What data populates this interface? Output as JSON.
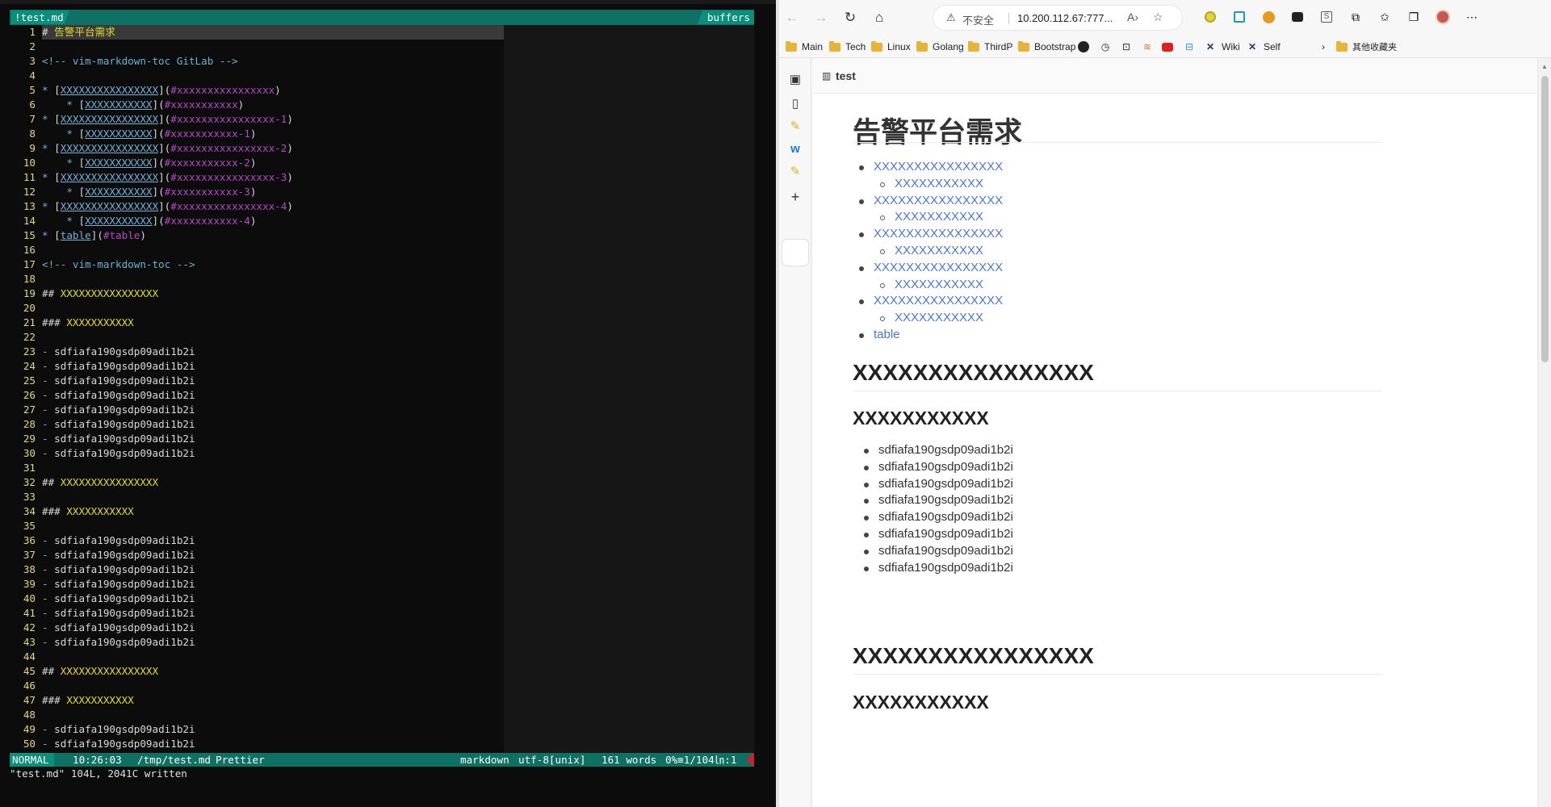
{
  "vim": {
    "tab": "!test.md",
    "buffers_label": "buffers",
    "lines": [
      {
        "n": "1",
        "parts": [
          {
            "t": "# ",
            "c": "c-plain"
          },
          {
            "t": "告警平台需求",
            "c": "c-head"
          }
        ]
      },
      {
        "n": "2",
        "parts": []
      },
      {
        "n": "3",
        "parts": [
          {
            "t": "<!-- vim-markdown-toc GitLab -->",
            "c": "c-comment"
          }
        ]
      },
      {
        "n": "4",
        "parts": []
      },
      {
        "n": "5",
        "parts": [
          {
            "t": "* ",
            "c": "c-bullet"
          },
          {
            "t": "[",
            "c": "c-plain"
          },
          {
            "t": "XXXXXXXXXXXXXXXX",
            "c": "c-link"
          },
          {
            "t": "](",
            "c": "c-plain"
          },
          {
            "t": "#xxxxxxxxxxxxxxxx",
            "c": "c-anchor"
          },
          {
            "t": ")",
            "c": "c-plain"
          }
        ]
      },
      {
        "n": "6",
        "parts": [
          {
            "t": "    * ",
            "c": "c-bullet"
          },
          {
            "t": "[",
            "c": "c-plain"
          },
          {
            "t": "XXXXXXXXXXX",
            "c": "c-link"
          },
          {
            "t": "](",
            "c": "c-plain"
          },
          {
            "t": "#xxxxxxxxxxx",
            "c": "c-anchor"
          },
          {
            "t": ")",
            "c": "c-plain"
          }
        ]
      },
      {
        "n": "7",
        "parts": [
          {
            "t": "* ",
            "c": "c-bullet"
          },
          {
            "t": "[",
            "c": "c-plain"
          },
          {
            "t": "XXXXXXXXXXXXXXXX",
            "c": "c-link"
          },
          {
            "t": "](",
            "c": "c-plain"
          },
          {
            "t": "#xxxxxxxxxxxxxxxx-1",
            "c": "c-anchor"
          },
          {
            "t": ")",
            "c": "c-plain"
          }
        ]
      },
      {
        "n": "8",
        "parts": [
          {
            "t": "    * ",
            "c": "c-bullet"
          },
          {
            "t": "[",
            "c": "c-plain"
          },
          {
            "t": "XXXXXXXXXXX",
            "c": "c-link"
          },
          {
            "t": "](",
            "c": "c-plain"
          },
          {
            "t": "#xxxxxxxxxxx-1",
            "c": "c-anchor"
          },
          {
            "t": ")",
            "c": "c-plain"
          }
        ]
      },
      {
        "n": "9",
        "parts": [
          {
            "t": "* ",
            "c": "c-bullet"
          },
          {
            "t": "[",
            "c": "c-plain"
          },
          {
            "t": "XXXXXXXXXXXXXXXX",
            "c": "c-link"
          },
          {
            "t": "](",
            "c": "c-plain"
          },
          {
            "t": "#xxxxxxxxxxxxxxxx-2",
            "c": "c-anchor"
          },
          {
            "t": ")",
            "c": "c-plain"
          }
        ]
      },
      {
        "n": "10",
        "parts": [
          {
            "t": "    * ",
            "c": "c-bullet"
          },
          {
            "t": "[",
            "c": "c-plain"
          },
          {
            "t": "XXXXXXXXXXX",
            "c": "c-link"
          },
          {
            "t": "](",
            "c": "c-plain"
          },
          {
            "t": "#xxxxxxxxxxx-2",
            "c": "c-anchor"
          },
          {
            "t": ")",
            "c": "c-plain"
          }
        ]
      },
      {
        "n": "11",
        "parts": [
          {
            "t": "* ",
            "c": "c-bullet"
          },
          {
            "t": "[",
            "c": "c-plain"
          },
          {
            "t": "XXXXXXXXXXXXXXXX",
            "c": "c-link"
          },
          {
            "t": "](",
            "c": "c-plain"
          },
          {
            "t": "#xxxxxxxxxxxxxxxx-3",
            "c": "c-anchor"
          },
          {
            "t": ")",
            "c": "c-plain"
          }
        ]
      },
      {
        "n": "12",
        "parts": [
          {
            "t": "    * ",
            "c": "c-bullet"
          },
          {
            "t": "[",
            "c": "c-plain"
          },
          {
            "t": "XXXXXXXXXXX",
            "c": "c-link"
          },
          {
            "t": "](",
            "c": "c-plain"
          },
          {
            "t": "#xxxxxxxxxxx-3",
            "c": "c-anchor"
          },
          {
            "t": ")",
            "c": "c-plain"
          }
        ]
      },
      {
        "n": "13",
        "parts": [
          {
            "t": "* ",
            "c": "c-bullet"
          },
          {
            "t": "[",
            "c": "c-plain"
          },
          {
            "t": "XXXXXXXXXXXXXXXX",
            "c": "c-link"
          },
          {
            "t": "](",
            "c": "c-plain"
          },
          {
            "t": "#xxxxxxxxxxxxxxxx-4",
            "c": "c-anchor"
          },
          {
            "t": ")",
            "c": "c-plain"
          }
        ]
      },
      {
        "n": "14",
        "parts": [
          {
            "t": "    * ",
            "c": "c-bullet"
          },
          {
            "t": "[",
            "c": "c-plain"
          },
          {
            "t": "XXXXXXXXXXX",
            "c": "c-link"
          },
          {
            "t": "](",
            "c": "c-plain"
          },
          {
            "t": "#xxxxxxxxxxx-4",
            "c": "c-anchor"
          },
          {
            "t": ")",
            "c": "c-plain"
          }
        ]
      },
      {
        "n": "15",
        "parts": [
          {
            "t": "* ",
            "c": "c-bullet"
          },
          {
            "t": "[",
            "c": "c-plain"
          },
          {
            "t": "table",
            "c": "c-link"
          },
          {
            "t": "](",
            "c": "c-plain"
          },
          {
            "t": "#table",
            "c": "c-anchor"
          },
          {
            "t": ")",
            "c": "c-plain"
          }
        ]
      },
      {
        "n": "16",
        "parts": []
      },
      {
        "n": "17",
        "parts": [
          {
            "t": "<!-- vim-markdown-toc -->",
            "c": "c-comment"
          }
        ]
      },
      {
        "n": "18",
        "parts": []
      },
      {
        "n": "19",
        "parts": [
          {
            "t": "## ",
            "c": "c-plain"
          },
          {
            "t": "XXXXXXXXXXXXXXXX",
            "c": "c-head"
          }
        ]
      },
      {
        "n": "20",
        "parts": []
      },
      {
        "n": "21",
        "parts": [
          {
            "t": "### ",
            "c": "c-plain"
          },
          {
            "t": "XXXXXXXXXXX",
            "c": "c-head"
          }
        ]
      },
      {
        "n": "22",
        "parts": []
      },
      {
        "n": "23",
        "parts": [
          {
            "t": "- ",
            "c": "c-bullet"
          },
          {
            "t": "sdfiafa190gsdp09adi1b2i",
            "c": "c-plain"
          }
        ]
      },
      {
        "n": "24",
        "parts": [
          {
            "t": "- ",
            "c": "c-bullet"
          },
          {
            "t": "sdfiafa190gsdp09adi1b2i",
            "c": "c-plain"
          }
        ]
      },
      {
        "n": "25",
        "parts": [
          {
            "t": "- ",
            "c": "c-bullet"
          },
          {
            "t": "sdfiafa190gsdp09adi1b2i",
            "c": "c-plain"
          }
        ]
      },
      {
        "n": "26",
        "parts": [
          {
            "t": "- ",
            "c": "c-bullet"
          },
          {
            "t": "sdfiafa190gsdp09adi1b2i",
            "c": "c-plain"
          }
        ]
      },
      {
        "n": "27",
        "parts": [
          {
            "t": "- ",
            "c": "c-bullet"
          },
          {
            "t": "sdfiafa190gsdp09adi1b2i",
            "c": "c-plain"
          }
        ]
      },
      {
        "n": "28",
        "parts": [
          {
            "t": "- ",
            "c": "c-bullet"
          },
          {
            "t": "sdfiafa190gsdp09adi1b2i",
            "c": "c-plain"
          }
        ]
      },
      {
        "n": "29",
        "parts": [
          {
            "t": "- ",
            "c": "c-bullet"
          },
          {
            "t": "sdfiafa190gsdp09adi1b2i",
            "c": "c-plain"
          }
        ]
      },
      {
        "n": "30",
        "parts": [
          {
            "t": "- ",
            "c": "c-bullet"
          },
          {
            "t": "sdfiafa190gsdp09adi1b2i",
            "c": "c-plain"
          }
        ]
      },
      {
        "n": "31",
        "parts": []
      },
      {
        "n": "32",
        "parts": [
          {
            "t": "## ",
            "c": "c-plain"
          },
          {
            "t": "XXXXXXXXXXXXXXXX",
            "c": "c-head"
          }
        ]
      },
      {
        "n": "33",
        "parts": []
      },
      {
        "n": "34",
        "parts": [
          {
            "t": "### ",
            "c": "c-plain"
          },
          {
            "t": "XXXXXXXXXXX",
            "c": "c-head"
          }
        ]
      },
      {
        "n": "35",
        "parts": []
      },
      {
        "n": "36",
        "parts": [
          {
            "t": "- ",
            "c": "c-bullet"
          },
          {
            "t": "sdfiafa190gsdp09adi1b2i",
            "c": "c-plain"
          }
        ]
      },
      {
        "n": "37",
        "parts": [
          {
            "t": "- ",
            "c": "c-bullet"
          },
          {
            "t": "sdfiafa190gsdp09adi1b2i",
            "c": "c-plain"
          }
        ]
      },
      {
        "n": "38",
        "parts": [
          {
            "t": "- ",
            "c": "c-bullet"
          },
          {
            "t": "sdfiafa190gsdp09adi1b2i",
            "c": "c-plain"
          }
        ]
      },
      {
        "n": "39",
        "parts": [
          {
            "t": "- ",
            "c": "c-bullet"
          },
          {
            "t": "sdfiafa190gsdp09adi1b2i",
            "c": "c-plain"
          }
        ]
      },
      {
        "n": "40",
        "parts": [
          {
            "t": "- ",
            "c": "c-bullet"
          },
          {
            "t": "sdfiafa190gsdp09adi1b2i",
            "c": "c-plain"
          }
        ]
      },
      {
        "n": "41",
        "parts": [
          {
            "t": "- ",
            "c": "c-bullet"
          },
          {
            "t": "sdfiafa190gsdp09adi1b2i",
            "c": "c-plain"
          }
        ]
      },
      {
        "n": "42",
        "parts": [
          {
            "t": "- ",
            "c": "c-bullet"
          },
          {
            "t": "sdfiafa190gsdp09adi1b2i",
            "c": "c-plain"
          }
        ]
      },
      {
        "n": "43",
        "parts": [
          {
            "t": "- ",
            "c": "c-bullet"
          },
          {
            "t": "sdfiafa190gsdp09adi1b2i",
            "c": "c-plain"
          }
        ]
      },
      {
        "n": "44",
        "parts": []
      },
      {
        "n": "45",
        "parts": [
          {
            "t": "## ",
            "c": "c-plain"
          },
          {
            "t": "XXXXXXXXXXXXXXXX",
            "c": "c-head"
          }
        ]
      },
      {
        "n": "46",
        "parts": []
      },
      {
        "n": "47",
        "parts": [
          {
            "t": "### ",
            "c": "c-plain"
          },
          {
            "t": "XXXXXXXXXXX",
            "c": "c-head"
          }
        ]
      },
      {
        "n": "48",
        "parts": []
      },
      {
        "n": "49",
        "parts": [
          {
            "t": "- ",
            "c": "c-bullet"
          },
          {
            "t": "sdfiafa190gsdp09adi1b2i",
            "c": "c-plain"
          }
        ]
      },
      {
        "n": "50",
        "parts": [
          {
            "t": "- ",
            "c": "c-bullet"
          },
          {
            "t": "sdfiafa190gsdp09adi1b2i",
            "c": "c-plain"
          }
        ]
      }
    ],
    "status": {
      "mode": "NORMAL",
      "time": "10:26:03",
      "path": "/tmp/test.md",
      "formatter": "Prettier",
      "filetype": "markdown",
      "encoding": "utf-8[unix]",
      "words": "161 words",
      "position": "0%≡1/104㏑:1"
    },
    "cmdline": "\"test.md\" 104L, 2041C written"
  },
  "browser": {
    "address": {
      "security": "不安全",
      "url": "10.200.112.67:777..."
    },
    "bookmarks": [
      "Main",
      "Tech",
      "Linux",
      "Golang",
      "ThirdP",
      "Bootstrap",
      "Wiki",
      "Self"
    ],
    "other_bookmarks": "其他收藏夹",
    "page_tab_title": "test",
    "doc": {
      "title": "告警平台需求",
      "toc": [
        {
          "label": "XXXXXXXXXXXXXXXX",
          "level": 1
        },
        {
          "label": "XXXXXXXXXXX",
          "level": 2
        },
        {
          "label": "XXXXXXXXXXXXXXXX",
          "level": 1
        },
        {
          "label": "XXXXXXXXXXX",
          "level": 2
        },
        {
          "label": "XXXXXXXXXXXXXXXX",
          "level": 1
        },
        {
          "label": "XXXXXXXXXXX",
          "level": 2
        },
        {
          "label": "XXXXXXXXXXXXXXXX",
          "level": 1
        },
        {
          "label": "XXXXXXXXXXX",
          "level": 2
        },
        {
          "label": "XXXXXXXXXXXXXXXX",
          "level": 1
        },
        {
          "label": "XXXXXXXXXXX",
          "level": 2
        },
        {
          "label": "table",
          "level": 1
        }
      ],
      "section1_h2": "XXXXXXXXXXXXXXXX",
      "section1_h3": "XXXXXXXXXXX",
      "items": [
        "sdfiafa190gsdp09adi1b2i",
        "sdfiafa190gsdp09adi1b2i",
        "sdfiafa190gsdp09adi1b2i",
        "sdfiafa190gsdp09adi1b2i",
        "sdfiafa190gsdp09adi1b2i",
        "sdfiafa190gsdp09adi1b2i",
        "sdfiafa190gsdp09adi1b2i",
        "sdfiafa190gsdp09adi1b2i"
      ],
      "section2_h2": "XXXXXXXXXXXXXXXX",
      "section2_h3": "XXXXXXXXXXX"
    }
  }
}
